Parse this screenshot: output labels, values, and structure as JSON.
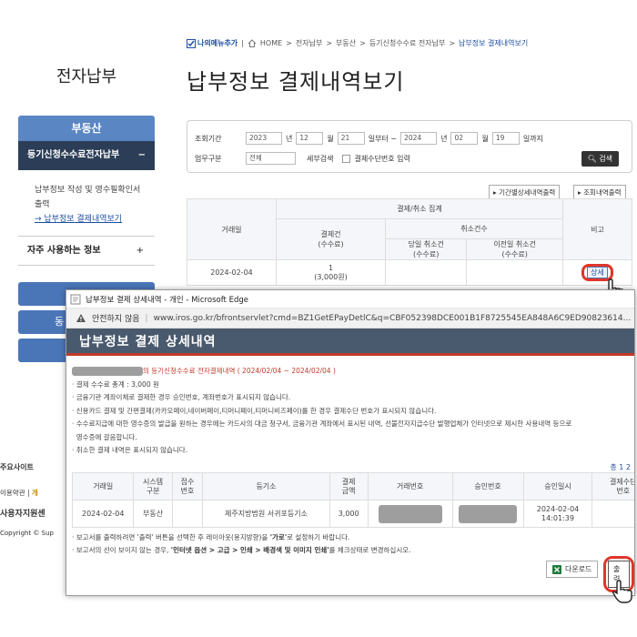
{
  "site": {
    "title": "전자납부",
    "side_menu": {
      "header": "부동산",
      "section": "등기신청수수료전자납부",
      "section_toggle": "−",
      "links": [
        "납부정보 작성 및 영수필확인서 출력",
        "→ 납부정보 결제내역보기"
      ],
      "fav_label": "자주 사용하는 정보",
      "fav_toggle": "+",
      "partial_buttons": [
        "",
        "동",
        ""
      ]
    }
  },
  "breadcrumb": {
    "my_menu": "나의메뉴추가",
    "items": [
      "HOME",
      "전자납부",
      "부동산",
      "등기신청수수료 전자납부"
    ],
    "current": "납부정보 결제내역보기"
  },
  "page_title": "납부정보 결제내역보기",
  "search": {
    "period_label": "조회기간",
    "from_year": "2023",
    "year_unit": "년",
    "from_month": "12",
    "month_unit": "월",
    "from_day": "21",
    "from_suffix": "일부터 ~",
    "to_year": "2024",
    "to_month": "02",
    "to_day": "19",
    "to_suffix": "일까지",
    "type_label": "업무구분",
    "type_value": "전체",
    "detail_label": "세부검색",
    "checkbox_label": "결제수단번호 입력",
    "button": "검색"
  },
  "table_buttons": [
    "기간별상세내역출력",
    "조회내역출력"
  ],
  "list_table": {
    "headers": {
      "date": "거래일",
      "group": "결제/취소 집계",
      "pay": "결제건\n(수수료)",
      "cancel_group": "취소건수",
      "same_day": "당일 취소건\n(수수료)",
      "prev_day": "이전일 취소건\n(수수료)",
      "note": "비고"
    },
    "rows": [
      {
        "date": "2024-02-04",
        "pay_count": "1",
        "pay_fee": "(3,000원)",
        "same_day": "",
        "prev_day": "",
        "note": "상세"
      }
    ]
  },
  "popup": {
    "window_title": "납부정보 결제 상세내역 - 개인 - Microsoft Edge",
    "warning": "안전하지 않음",
    "url": "www.iros.go.kr/bfrontservlet?cmd=BZ1GetEPayDetlC&q=CBF052398DCE001B1F8725545EA848A6C9ED90823614...",
    "header": "납부정보 결제 상세내역",
    "summary": "의 등기신청수수료 전자결제내역 ( 2024/02/04 ~ 2024/02/04 )",
    "notes": [
      "· 결제 수수료 총계 : 3,000 원",
      "· 금융기관 계좌이체로 결제한 경우 승인번호, 계좌번호가 표시되지 않습니다.",
      "· 신용카드 결제 및 간편결제(카카오페이,네이버페이,티머니페이,티머니비즈페이)를 한 경우 결제수단 번호가 표시되지 않습니다.",
      "· 수수료지급에 대한 영수증의 발급을 원하는 경우에는 카드사의 대금 청구서, 금융기관 계좌에서 표시된 내역, 선불전자지급수단 발행업체가 인터넷으로 제시한 사용내역 등으로",
      "  영수증에 갈음합니다.",
      "· 취소한 결제 내역은 표시되지 않습니다."
    ],
    "total_label": "총 1 2",
    "table": {
      "headers": [
        "거래일",
        "시스템\n구분",
        "접수\n번호",
        "등기소",
        "결제\n금액",
        "거래번호",
        "승인번호",
        "승인일시",
        "결제수단\n번호"
      ],
      "rows": [
        [
          "2024-02-04",
          "부동산",
          "",
          "제주지방법원 서귀포등기소",
          "3,000",
          "",
          "",
          "2024-02-04\n14:01:39",
          ""
        ]
      ]
    },
    "bottom_notes": [
      {
        "pre": "· 보고서를 출력하려면 '출력' 버튼을 선택한 후 레이아웃(용지방향)을 ",
        "bold": "'가로'",
        "post": "로 설정하기 바랍니다."
      },
      {
        "pre": "· 보고서의 선이 보이지 않는 경우, ",
        "bold": "'인터넷 옵션 > 고급 > 인쇄 > 배경색 및 이미지 인쇄'",
        "post": "를 체크상태로 변경하십시오."
      }
    ],
    "download_button": "다운로드",
    "print_button": "출력"
  },
  "left_footer": {
    "title": "주요사이트",
    "links": [
      "이용약관",
      "|",
      "개"
    ],
    "org": "사용자지원센",
    "copyright": "Copyright © Sup"
  },
  "colors": {
    "accent_blue": "#5b86c4",
    "dark_navy": "#2c3e57",
    "highlight_red": "#e0352b",
    "popup_header": "#4a5a6e"
  }
}
